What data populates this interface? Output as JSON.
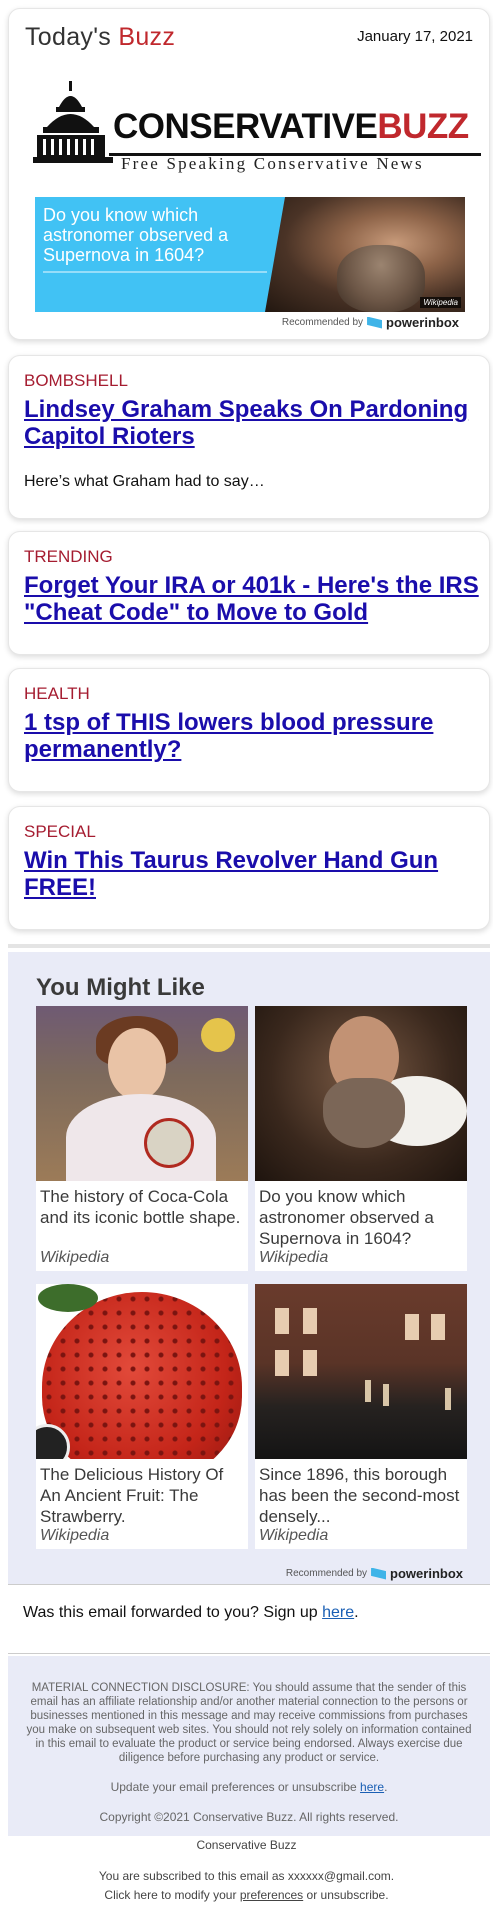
{
  "header": {
    "brand_prefix": "Today's ",
    "brand_accent": "Buzz",
    "date": "January 17, 2021",
    "logo_word1": "CONSERVATIVE",
    "logo_word2": "BUZZ",
    "logo_tagline": "Free Speaking Conservative News",
    "ad": {
      "text": "Do you know which astronomer observed a Supernova in 1604?",
      "credit": "Wikipedia"
    },
    "recommended_by": "Recommended by",
    "provider": "powerinbox"
  },
  "stories": [
    {
      "category": "BOMBSHELL",
      "headline": "Lindsey Graham Speaks On Pardoning Capitol Rioters",
      "teaser": "Here’s what Graham had to say…"
    },
    {
      "category": "TRENDING",
      "headline": "Forget Your IRA or 401k - Here's the IRS \"Cheat Code\" to Move to Gold"
    },
    {
      "category": "HEALTH",
      "headline": "1 tsp of THIS lowers blood pressure permanently?"
    },
    {
      "category": "SPECIAL",
      "headline": "Win This Taurus Revolver Hand Gun FREE!"
    }
  ],
  "you_might_like": {
    "title": "You Might Like",
    "tiles": [
      {
        "caption": "The history of Coca-Cola and its iconic bottle shape.",
        "source": "Wikipedia"
      },
      {
        "caption": "Do you know which astronomer observed a Supernova in 1604?",
        "source": "Wikipedia"
      },
      {
        "caption": "The Delicious History Of An Ancient Fruit: The Strawberry.",
        "source": "Wikipedia"
      },
      {
        "caption": "Since 1896, this borough has been the second-most densely...",
        "source": "Wikipedia"
      }
    ],
    "recommended_by": "Recommended by",
    "provider": "powerinbox"
  },
  "forward": {
    "text": "Was this email forwarded to you? Sign up ",
    "link": "here",
    "end": "."
  },
  "disclosure": {
    "text": "MATERIAL CONNECTION DISCLOSURE: You should assume that the sender of this email has an affiliate relationship and/or another material connection to the persons or businesses mentioned in this message and may receive commissions from purchases you make on subsequent web sites. You should not rely solely on information contained in this email to evaluate the product or service being endorsed. Always exercise due diligence before purchasing any product or service.",
    "update_text": "Update your email preferences or unsubscribe ",
    "update_link": "here",
    "update_end": ".",
    "copyright": "Copyright ©2021 Conservative Buzz. All rights reserved."
  },
  "footer": {
    "name": "Conservative Buzz",
    "subscribed": "You are subscribed to this email as xxxxxx@gmail.com.",
    "modify_prefix": "Click here to modify your ",
    "modify_link": "preferences",
    "modify_suffix": " or unsubscribe."
  },
  "colors": {
    "accent_red": "#c0282d",
    "category_red": "#a51c30",
    "link_blue": "#1a0dab",
    "ad_blue": "#41c2f4",
    "panel_bg": "#e9ebf7"
  },
  "icons": {
    "logo": "capitol-dome-icon",
    "provider": "powerinbox-icon"
  }
}
